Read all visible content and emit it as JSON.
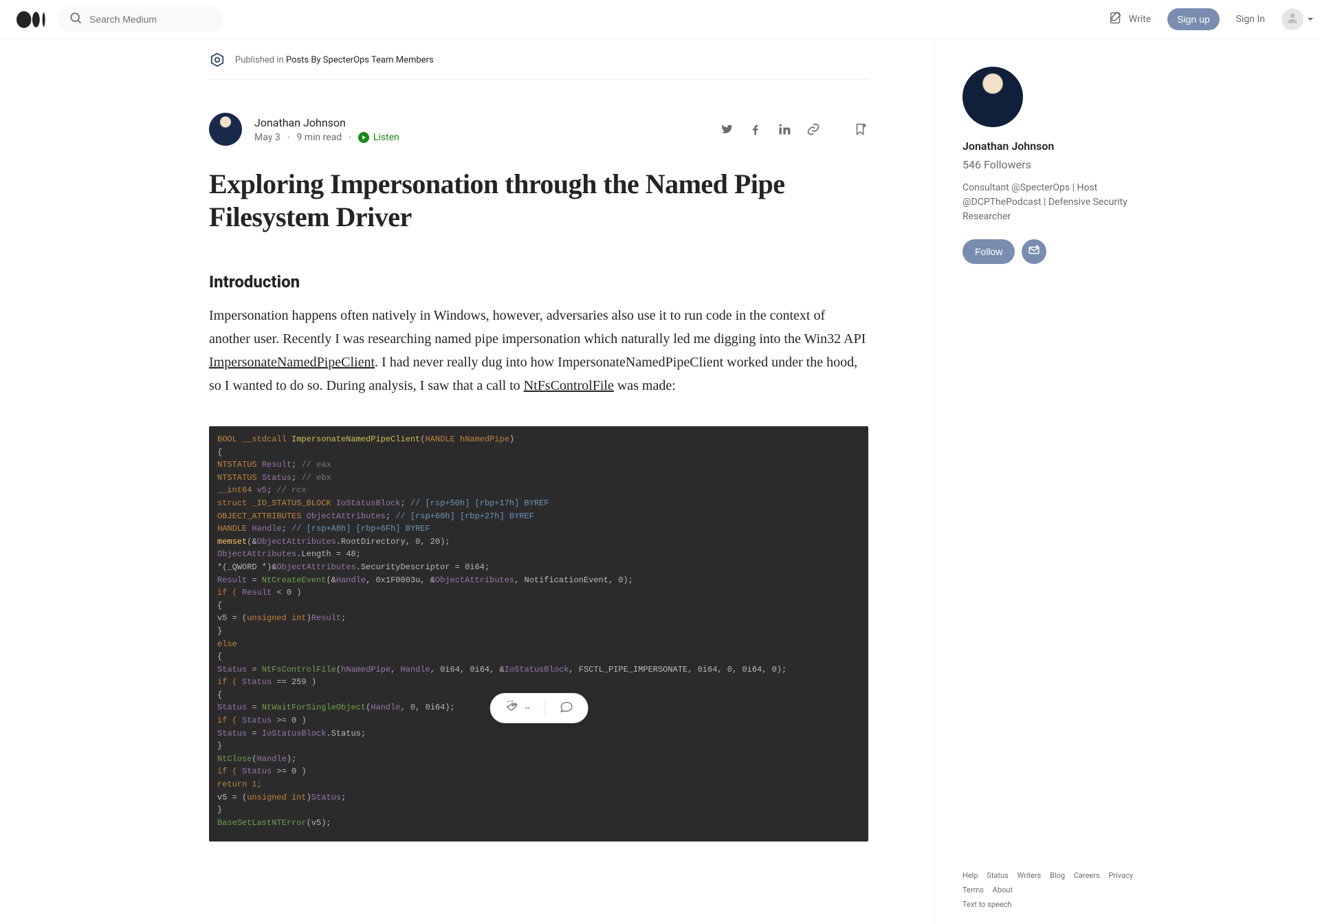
{
  "header": {
    "search_placeholder": "Search Medium",
    "write_label": "Write",
    "signup_label": "Sign up",
    "signin_label": "Sign In"
  },
  "publication": {
    "prefix": "Published in",
    "name": "Posts By SpecterOps Team Members"
  },
  "author": {
    "name": "Jonathan Johnson",
    "date": "May 3",
    "read_time": "9 min read",
    "listen_label": "Listen"
  },
  "icons": {
    "twitter": "twitter-icon",
    "facebook": "facebook-icon",
    "linkedin": "linkedin-icon",
    "link": "link-icon",
    "bookmark": "bookmark-icon",
    "clap": "clap-icon",
    "comment": "comment-icon",
    "mail": "mail-icon"
  },
  "article": {
    "title": "Exploring Impersonation through the Named Pipe Filesystem Driver",
    "section_intro": "Introduction",
    "para1_a": "Impersonation happens often natively in Windows, however, adversaries also use it to run code in the context of another user. Recently I was researching named pipe impersonation which naturally led me digging into the Win32 API ",
    "para1_link1": "ImpersonateNamedPipeClient",
    "para1_b": ". I had never really dug into how ImpersonateNamedPipeClient worked under the hood, so I wanted to do so. During analysis, I saw that a call to ",
    "para1_link2": "NtFsControlFile",
    "para1_c": " was made:"
  },
  "code": {
    "l01a": "BOOL __stdcall ",
    "l01b": "ImpersonateNamedPipeClient",
    "l01c": "(",
    "l01d": "HANDLE hNamedPipe",
    "l01e": ")",
    "l02": "{",
    "l03a": "  NTSTATUS ",
    "l03b": "Result",
    "l03c": "; ",
    "l03d": "// eax",
    "l04a": "  NTSTATUS ",
    "l04b": "Status",
    "l04c": "; ",
    "l04d": "// ebx",
    "l05a": "  __int64 ",
    "l05b": "v5",
    "l05c": "; ",
    "l05d": "// rcx",
    "l06a": "  struct _IO_STATUS_BLOCK ",
    "l06b": "IoStatusBlock",
    "l06c": "; ",
    "l06d": "// [rsp+50h] [rbp+17h] BYREF",
    "l07a": "  OBJECT_ATTRIBUTES ",
    "l07b": "ObjectAttributes",
    "l07c": "; ",
    "l07d": "// [rsp+60h] [rbp+27h] BYREF",
    "l08a": "  HANDLE ",
    "l08b": "Handle",
    "l08c": "; ",
    "l08d": "// [rsp+A8h] [rbp+6Fh] BYREF",
    "l09": "",
    "l10a": "  memset",
    "l10b": "(&",
    "l10c": "ObjectAttributes",
    "l10d": ".RootDirectory, 0, 20);",
    "l11a": "  ObjectAttributes",
    "l11b": ".Length = 48;",
    "l12a": "  *(_QWORD *)&",
    "l12b": "ObjectAttributes",
    "l12c": ".SecurityDescriptor = 0i64;",
    "l13a": "  Result",
    "l13b": " = ",
    "l13c": "NtCreateEvent",
    "l13d": "(&",
    "l13e": "Handle",
    "l13f": ", 0x1F0003u, &",
    "l13g": "ObjectAttributes",
    "l13h": ", NotificationEvent, 0);",
    "l14a": "  if ( ",
    "l14b": "Result",
    "l14c": " < 0 )",
    "l15": "  {",
    "l16a": "    v5 = (",
    "l16b": "unsigned int",
    "l16c": ")",
    "l16d": "Result",
    "l16e": ";",
    "l17": "  }",
    "l18": "  else",
    "l19": "  {",
    "l20a": "    Status",
    "l20b": " = ",
    "l20c": "NtFsControlFile",
    "l20d": "(",
    "l20e": "hNamedPipe",
    "l20f": ", ",
    "l20g": "Handle",
    "l20h": ", 0i64, 0i64, &",
    "l20i": "IoStatusBlock",
    "l20j": ", FSCTL_PIPE_IMPERSONATE, 0i64, 0, 0i64, 0);",
    "l21a": "    if ( ",
    "l21b": "Status",
    "l21c": " == 259 )",
    "l22": "    {",
    "l23a": "      Status",
    "l23b": " = ",
    "l23c": "NtWaitForSingleObject",
    "l23d": "(",
    "l23e": "Handle",
    "l23f": ", 0, 0i64);",
    "l24a": "      if ( ",
    "l24b": "Status",
    "l24c": " >= 0 )",
    "l25a": "        Status",
    "l25b": " = ",
    "l25c": "IoStatusBlock",
    "l25d": ".Status;",
    "l26": "    }",
    "l27a": "    NtClose",
    "l27b": "(",
    "l27c": "Handle",
    "l27d": ");",
    "l28a": "    if ( ",
    "l28b": "Status",
    "l28c": " >= 0 )",
    "l29": "      return 1;",
    "l30a": "    v5 = (",
    "l30b": "unsigned int",
    "l30c": ")",
    "l30d": "Status",
    "l30e": ";",
    "l31": "  }",
    "l32a": "  BaseSetLastNTError",
    "l32b": "(v5);"
  },
  "reactions": {
    "clap_count": "--"
  },
  "sidebar": {
    "name": "Jonathan Johnson",
    "followers": "546 Followers",
    "bio": "Consultant @SpecterOps | Host @DCPThePodcast | Defensive Security Researcher",
    "follow_label": "Follow"
  },
  "footer_links": [
    "Help",
    "Status",
    "Writers",
    "Blog",
    "Careers",
    "Privacy",
    "Terms",
    "About",
    "Text to speech"
  ],
  "colors": {
    "accent": "#7a8db0",
    "link_green": "#1a8917"
  }
}
